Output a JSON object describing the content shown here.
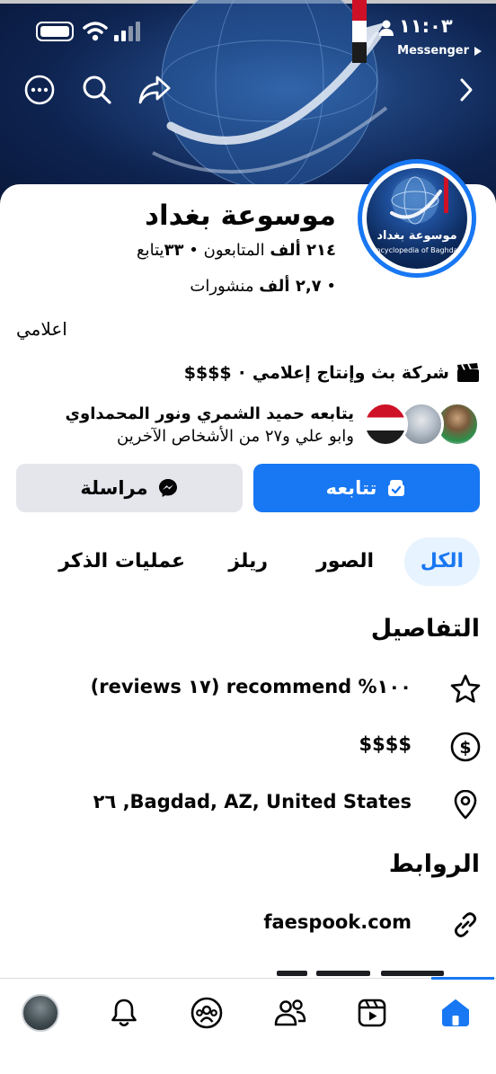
{
  "status_bar": {
    "time": "١١:٠٣",
    "back_app": "Messenger"
  },
  "header": {
    "icons": [
      "more-icon",
      "search-icon",
      "share-icon",
      "chevron-right-icon"
    ]
  },
  "profile": {
    "name": "موسوعة بغداد",
    "followers_count": "٢١٤ ألف",
    "followers_label": "المتابعون",
    "following_count": "٣٣",
    "following_label": "يتابع",
    "posts_count": "٢,٧ ألف",
    "posts_label": "منشورات",
    "avatar_title": "موسوعة بغداد",
    "avatar_subtitle": "Encyclopedia of Baghdad",
    "category": "اعلامي",
    "business_type": "شركة بث وإنتاج إعلامي",
    "price_range": "$$$$",
    "friends_line1": "يتابعه حميد الشمري ونور المحمداوي",
    "friends_line2": "وابو علي و٢٧ من الأشخاص الآخرين"
  },
  "actions": {
    "follow_label": "تتابعه",
    "message_label": "مراسلة"
  },
  "tabs": [
    {
      "label": "الكل",
      "active": true
    },
    {
      "label": "الصور",
      "active": false
    },
    {
      "label": "ريلز",
      "active": false
    },
    {
      "label": "عمليات الذكر",
      "active": false
    }
  ],
  "details": {
    "title": "التفاصيل",
    "recommend": "(reviews ١٧) recommend %١٠٠",
    "price": "$$$$",
    "address": "٢٦ ,Bagdad, AZ, United States"
  },
  "links": {
    "title": "الروابط",
    "website": "faespook.com"
  },
  "bottom_nav": {
    "items": [
      "profile-avatar",
      "bell-icon",
      "groups-icon",
      "friends-icon",
      "video-icon",
      "home-icon"
    ],
    "active": "home-icon"
  },
  "colors": {
    "accent": "#1877f2",
    "button_secondary": "#e4e6eb",
    "text": "#050505",
    "cover_dark": "#0e2350"
  }
}
